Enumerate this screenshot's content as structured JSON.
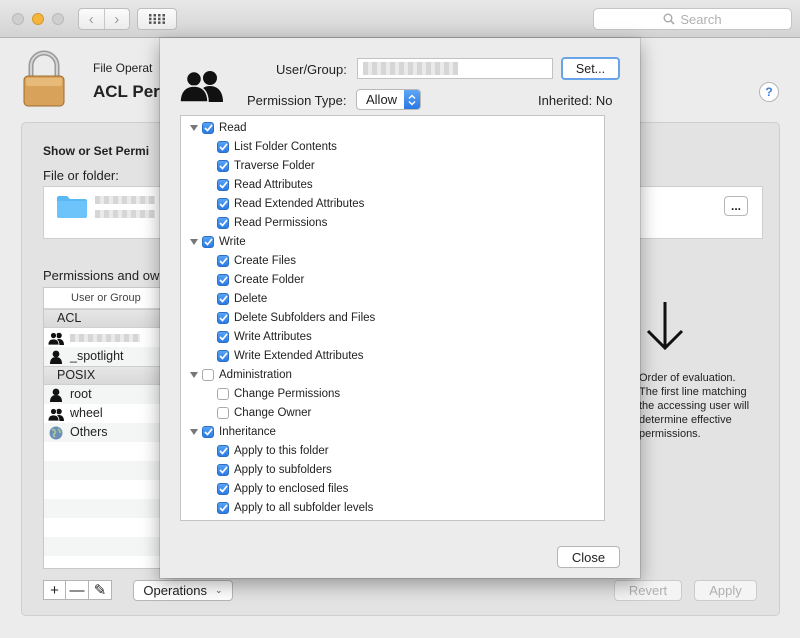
{
  "toolbar": {
    "search_placeholder": "Search",
    "back_glyph": "‹",
    "forward_glyph": "›"
  },
  "pane": {
    "subtitle": "File Operat",
    "title": "ACL Per",
    "help": "?",
    "section_heading": "Show or Set Permi",
    "file_label": "File or folder:",
    "ellipsis": "...",
    "permissions_label": "Permissions and ow",
    "column_header": "User or Group",
    "rows": [
      {
        "type": "group",
        "label": "ACL"
      },
      {
        "type": "user",
        "icon": "group-icon",
        "label": ""
      },
      {
        "type": "user",
        "icon": "user-icon",
        "label": "_spotlight"
      },
      {
        "type": "group",
        "label": "POSIX"
      },
      {
        "type": "user",
        "icon": "user-icon",
        "label": "root"
      },
      {
        "type": "user",
        "icon": "group-icon",
        "label": "wheel"
      },
      {
        "type": "user",
        "icon": "globe-icon",
        "label": "Others"
      }
    ],
    "add": "+",
    "remove": "—",
    "edit": "✎",
    "operations": "Operations",
    "revert": "Revert",
    "apply": "Apply",
    "evaluation_lines": [
      "Order of evaluation.",
      "The first line matching",
      "the accessing user will",
      "determine effective",
      "permissions."
    ]
  },
  "sheet": {
    "user_group_label": "User/Group:",
    "user_group_value": "",
    "set_button": "Set...",
    "permission_type_label": "Permission Type:",
    "permission_type_value": "Allow",
    "inherited_label": "Inherited:",
    "inherited_value": "No",
    "close_button": "Close",
    "permissions": [
      {
        "level": 0,
        "label": "Read",
        "checked": true
      },
      {
        "level": 1,
        "label": "List Folder Contents",
        "checked": true
      },
      {
        "level": 1,
        "label": "Traverse Folder",
        "checked": true
      },
      {
        "level": 1,
        "label": "Read Attributes",
        "checked": true
      },
      {
        "level": 1,
        "label": "Read Extended Attributes",
        "checked": true
      },
      {
        "level": 1,
        "label": "Read Permissions",
        "checked": true
      },
      {
        "level": 0,
        "label": "Write",
        "checked": true
      },
      {
        "level": 1,
        "label": "Create Files",
        "checked": true
      },
      {
        "level": 1,
        "label": "Create Folder",
        "checked": true
      },
      {
        "level": 1,
        "label": "Delete",
        "checked": true
      },
      {
        "level": 1,
        "label": "Delete Subfolders and Files",
        "checked": true
      },
      {
        "level": 1,
        "label": "Write Attributes",
        "checked": true
      },
      {
        "level": 1,
        "label": "Write Extended Attributes",
        "checked": true
      },
      {
        "level": 0,
        "label": "Administration",
        "checked": false
      },
      {
        "level": 1,
        "label": "Change Permissions",
        "checked": false
      },
      {
        "level": 1,
        "label": "Change Owner",
        "checked": false
      },
      {
        "level": 0,
        "label": "Inheritance",
        "checked": true
      },
      {
        "level": 1,
        "label": "Apply to this folder",
        "checked": true
      },
      {
        "level": 1,
        "label": "Apply to subfolders",
        "checked": true
      },
      {
        "level": 1,
        "label": "Apply to enclosed files",
        "checked": true
      },
      {
        "level": 1,
        "label": "Apply to all subfolder levels",
        "checked": true
      }
    ]
  },
  "colors": {
    "accent": "#2a7be4",
    "focus_ring": "#6aa4e8",
    "folder": "#5cb8f5",
    "lock": "#d9a25a"
  }
}
